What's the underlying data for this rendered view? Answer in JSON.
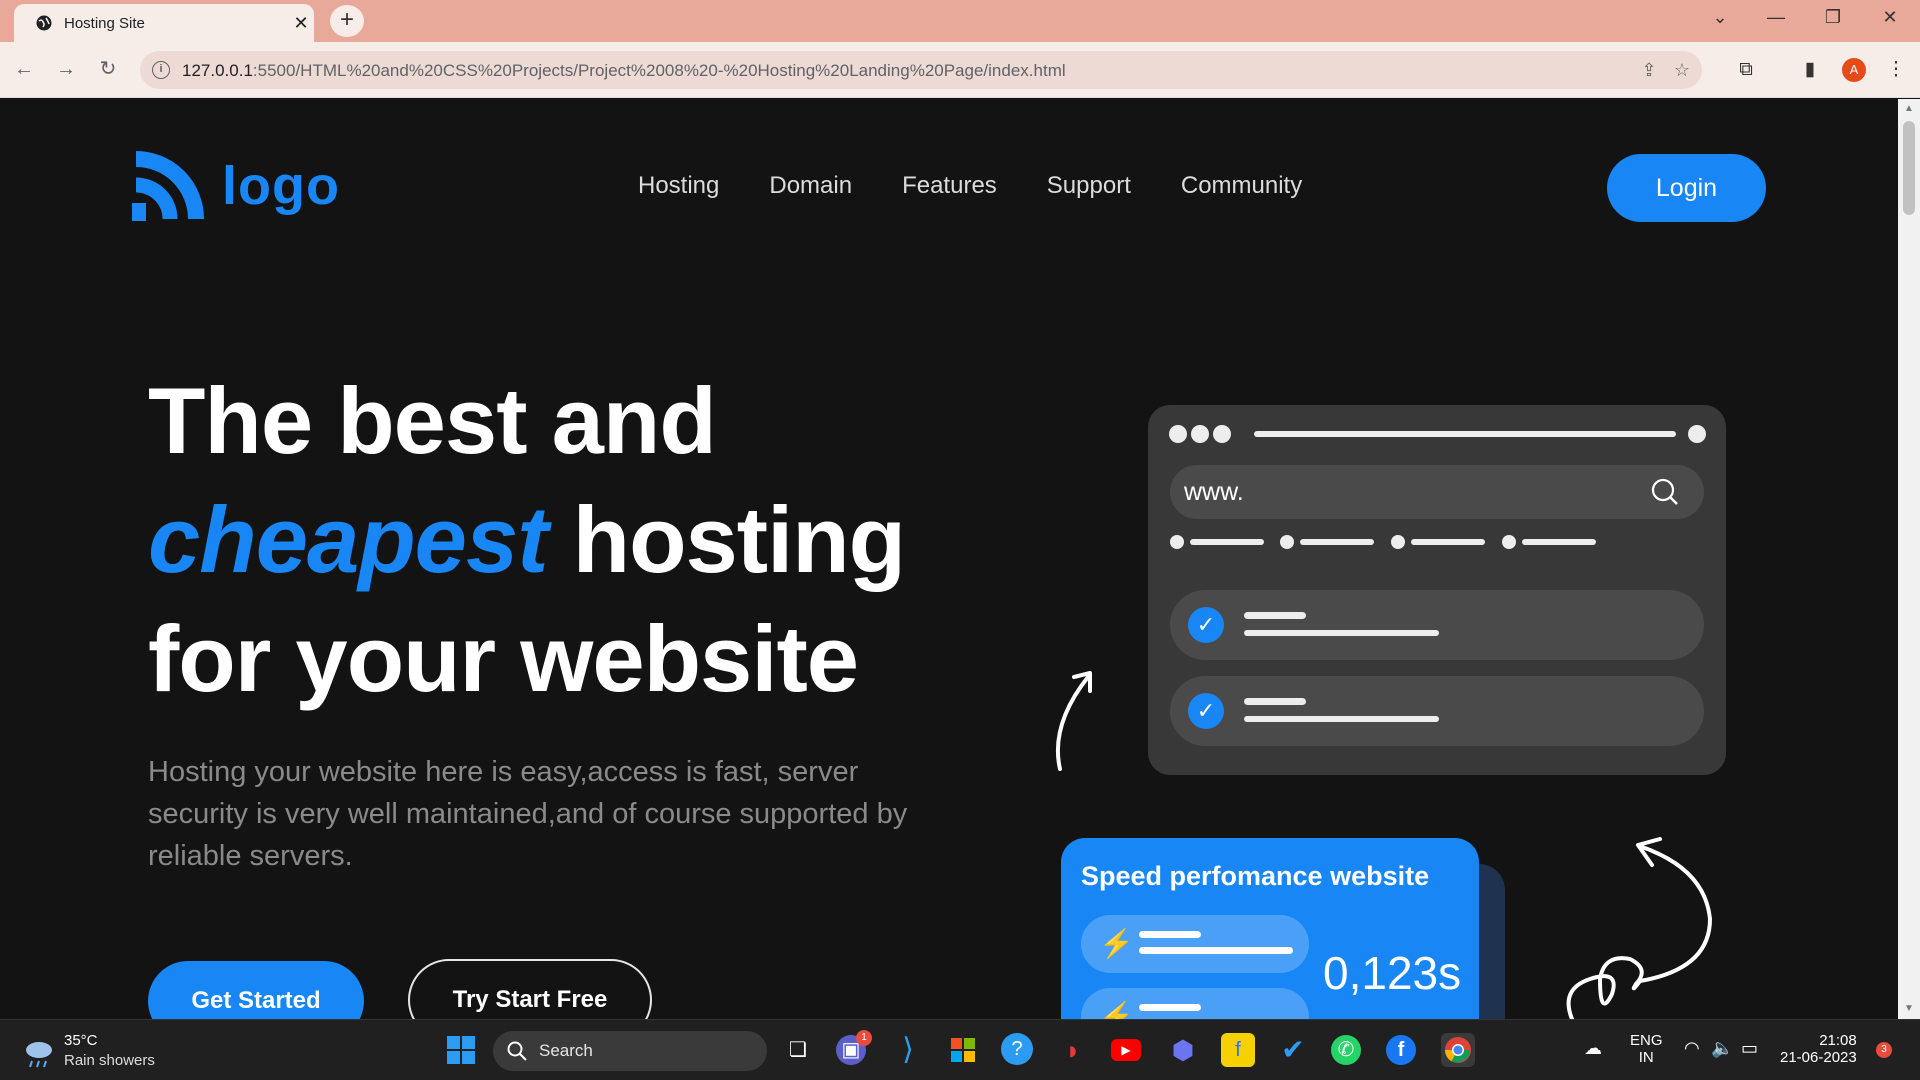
{
  "browser": {
    "tab_title": "Hosting Site",
    "new_tab": "+",
    "url_host": "127.0.0.1",
    "url_path": ":5500/HTML%20and%20CSS%20Projects/Project%2008%20-%20Hosting%20Landing%20Page/index.html",
    "profile_initial": "A"
  },
  "nav": {
    "logo_text": "logo",
    "links": [
      "Hosting",
      "Domain",
      "Features",
      "Support",
      "Community"
    ],
    "login": "Login"
  },
  "hero": {
    "line1": "The best and",
    "accent": "cheapest",
    "line2_rest": "hosting",
    "line3": "for your website",
    "description": "Hosting your website here is easy,access is fast, server security is very well maintained,and of course supported by reliable servers.",
    "cta_primary": "Get Started",
    "cta_secondary": "Try Start Free"
  },
  "illustration": {
    "url_prefix": "www.",
    "speed_title": "Speed perfomance website",
    "speed_value": "0,123s"
  },
  "taskbar": {
    "temperature": "35°C",
    "weather": "Rain showers",
    "search": "Search",
    "lang1": "ENG",
    "lang2": "IN",
    "time": "21:08",
    "date": "21-06-2023",
    "notifications": "3",
    "teams_badge": "1"
  },
  "colors": {
    "accent": "#1886f5",
    "background": "#131313",
    "tab_strip": "#e8a99a"
  }
}
